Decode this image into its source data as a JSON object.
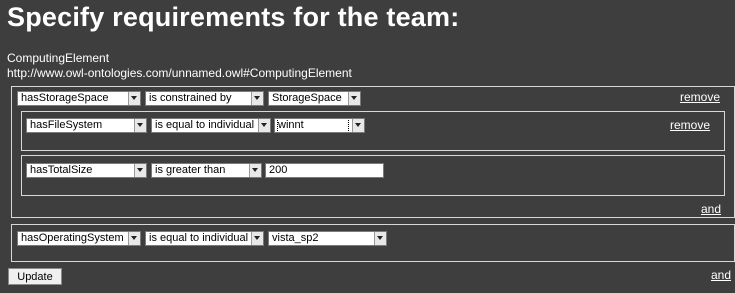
{
  "page": {
    "title": "Specify requirements for the team:",
    "class_name": "ComputingElement",
    "class_uri": "http://www.owl-ontologies.com/unnamed.owl#ComputingElement"
  },
  "restriction_1": {
    "property": "hasStorageSpace",
    "operator": "is constrained by",
    "value": "StorageSpace",
    "remove_label": "remove",
    "and_label": "and",
    "sub_1": {
      "property": "hasFileSystem",
      "operator": "is equal to individual",
      "value": "winnt",
      "remove_label": "remove"
    },
    "sub_2": {
      "property": "hasTotalSize",
      "operator": "is greater than",
      "value": "200"
    }
  },
  "restriction_2": {
    "property": "hasOperatingSystem",
    "operator": "is equal to individual",
    "value": "vista_sp2"
  },
  "footer": {
    "update_label": "Update",
    "and_label": "and"
  }
}
